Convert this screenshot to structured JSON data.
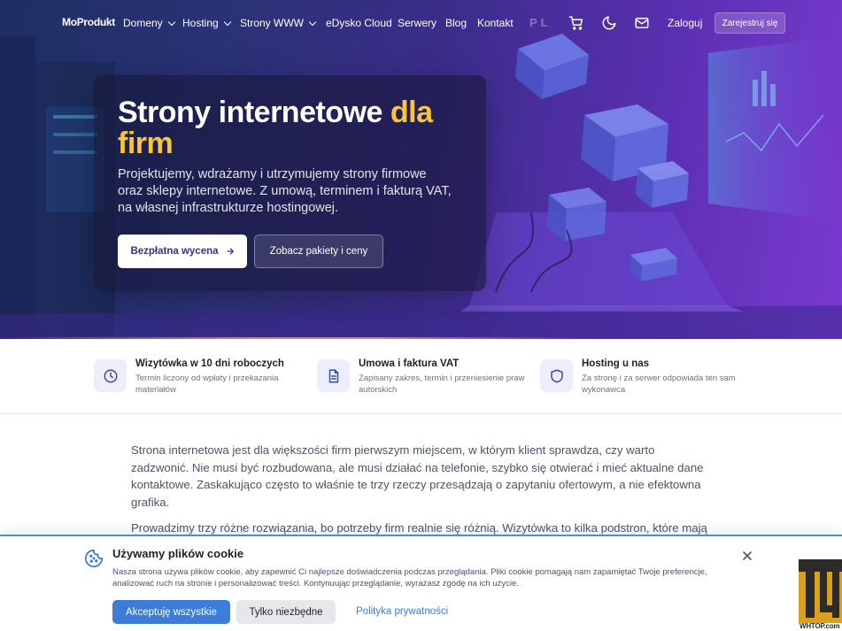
{
  "nav": {
    "logo": "MoProdukt",
    "items": [
      {
        "label": "Domeny",
        "dropdown": true
      },
      {
        "label": "Hosting",
        "dropdown": true
      },
      {
        "label": "Strony WWW",
        "dropdown": true
      },
      {
        "label": "eDysko Cloud",
        "dropdown": false
      },
      {
        "label": "Serwery",
        "dropdown": false
      },
      {
        "label": "Blog",
        "dropdown": false
      },
      {
        "label": "Kontakt",
        "dropdown": false
      }
    ],
    "lang": "PL",
    "icons": [
      "cart-icon",
      "moon-icon",
      "mail-icon"
    ],
    "login_label": "Zaloguj",
    "register_label": "Zarejestruj się"
  },
  "hero": {
    "title_main": "Strony internetowe ",
    "title_accent": "dla firm",
    "description": "Projektujemy, wdrażamy i utrzymujemy strony firmowe oraz sklepy internetowe. Z umową, terminem i fakturą VAT, na własnej infrastrukturze hostingowej.",
    "primary_button": "Bezpłatna wycena",
    "secondary_button": "Zobacz pakiety i ceny"
  },
  "features": [
    {
      "icon": "clock-icon",
      "title": "Wizytówka w 10 dni roboczych",
      "desc": "Termin liczony od wpłaty i przekazania materiałów"
    },
    {
      "icon": "document-icon",
      "title": "Umowa i faktura VAT",
      "desc": "Zapisany zakres, termin i przeniesienie praw autorskich"
    },
    {
      "icon": "shield-icon",
      "title": "Hosting u nas",
      "desc": "Za stronę i za serwer odpowiada ten sam wykonawca"
    }
  ],
  "content": {
    "paragraphs": [
      "Strona internetowa jest dla większości firm pierwszym miejscem, w którym klient sprawdza, czy warto zadzwonić. Nie musi być rozbudowana, ale musi działać na telefonie, szybko się otwierać i mieć aktualne dane kontaktowe. Zaskakująco często to właśnie te trzy rzeczy przesądzają o zapytaniu ofertowym, a nie efektowna grafika.",
      "Prowadzimy trzy różne rozwiązania, bo potrzeby firm realnie się różnią. Wizytówka to kilka podstron, które mają przedstawić firmę i umożliwić kontakt. Rozbudowana strona firmowa dokłada system do samodzielnego zarządzania"
    ]
  },
  "cookie": {
    "title": "Używamy plików cookie",
    "text": "Nasza strona używa plików cookie, aby zapewnić Ci najlepsze doświadczenia podczas przeglądania. Pliki cookie pomagają nam zapamiętać Twoje preferencje, analizować ruch na stronie i personalizować treści. Kontynuując przeglądanie, wyrażasz zgodę na ich użycie.",
    "accept_label": "Akceptuję wszystkie",
    "necessary_label": "Tylko niezbędne",
    "policy_label": "Polityka prywatności"
  },
  "watermark": {
    "text": "WHTOP.com"
  },
  "colors": {
    "accent_yellow": "#f9c43a",
    "primary_blue": "#3b7dd8",
    "hero_purple": "#5a2fb0"
  }
}
